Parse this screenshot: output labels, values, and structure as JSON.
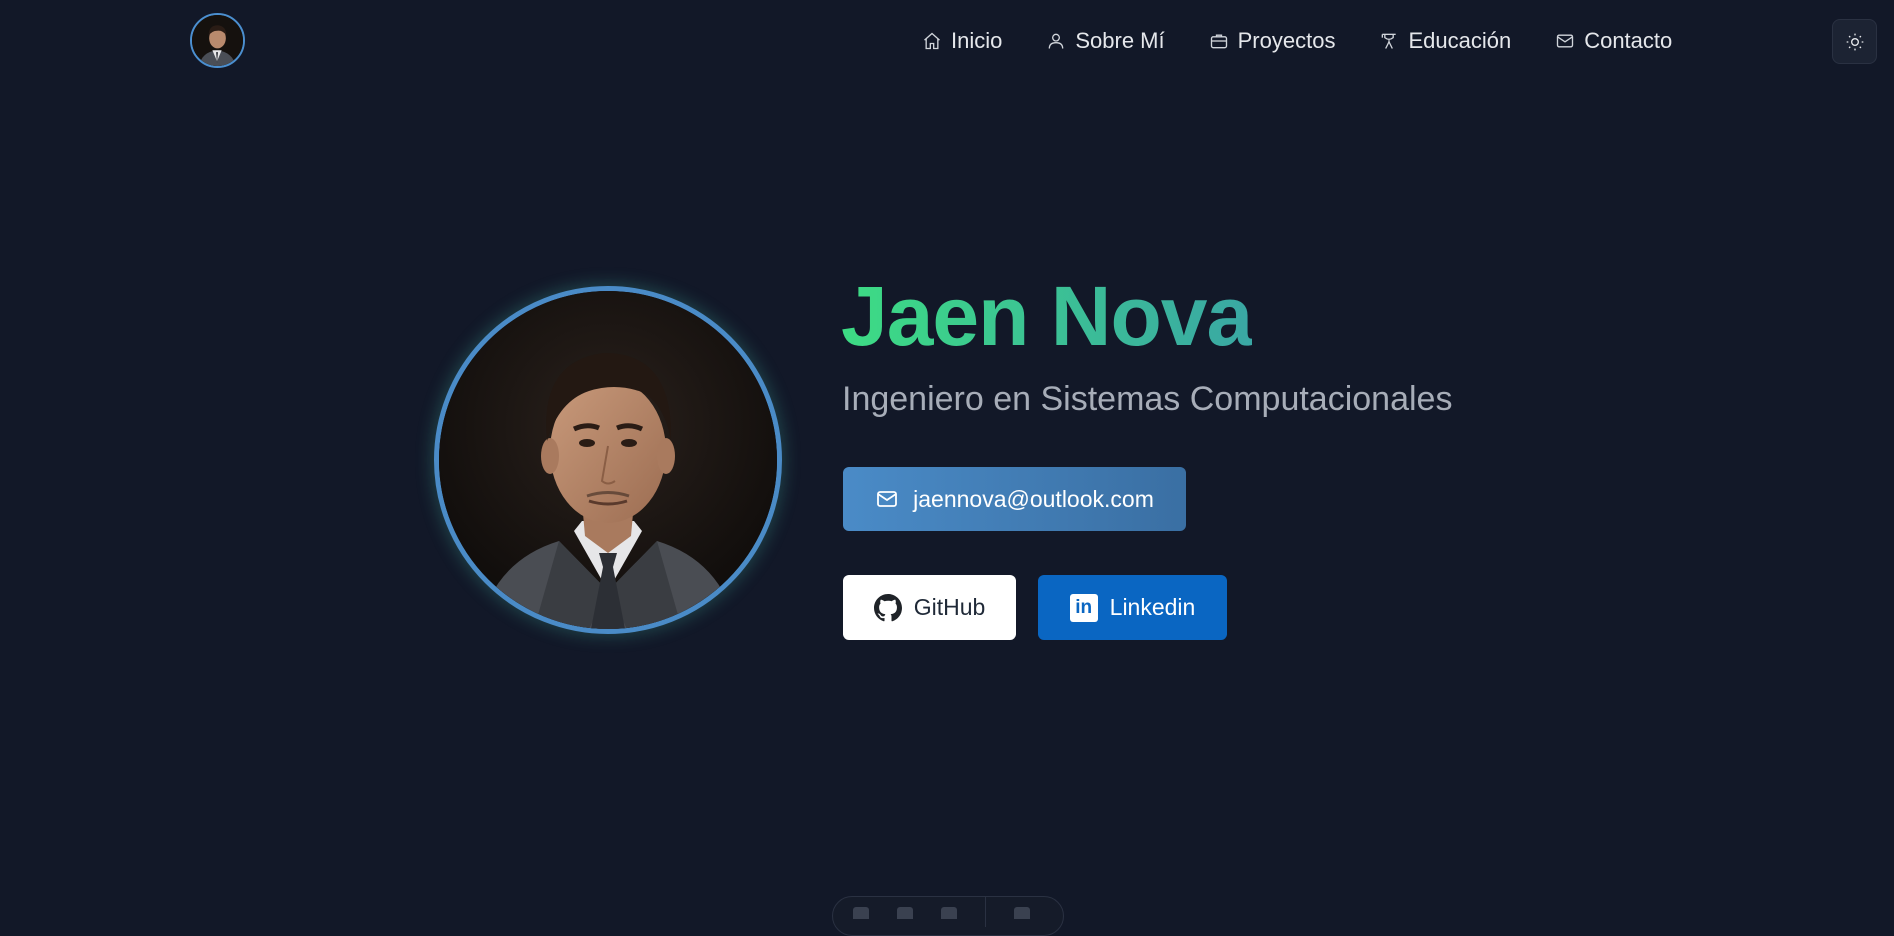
{
  "header": {
    "nav": [
      {
        "label": "Inicio",
        "icon": "home-icon"
      },
      {
        "label": "Sobre Mí",
        "icon": "user-icon"
      },
      {
        "label": "Proyectos",
        "icon": "briefcase-icon"
      },
      {
        "label": "Educación",
        "icon": "graduation-icon"
      },
      {
        "label": "Contacto",
        "icon": "mail-icon"
      }
    ],
    "theme_toggle_icon": "sun-icon"
  },
  "hero": {
    "name": "Jaen Nova",
    "subtitle": "Ingeniero en Sistemas Computacionales",
    "email": "jaennova@outlook.com",
    "github_label": "GitHub",
    "linkedin_label": "Linkedin",
    "linkedin_logo": "in"
  },
  "colors": {
    "background": "#121828",
    "name_gradient_start": "#3ddc84",
    "name_gradient_end": "#3aa7a4",
    "email_button": "#4a8bc7",
    "linkedin_button": "#0a66c2"
  }
}
